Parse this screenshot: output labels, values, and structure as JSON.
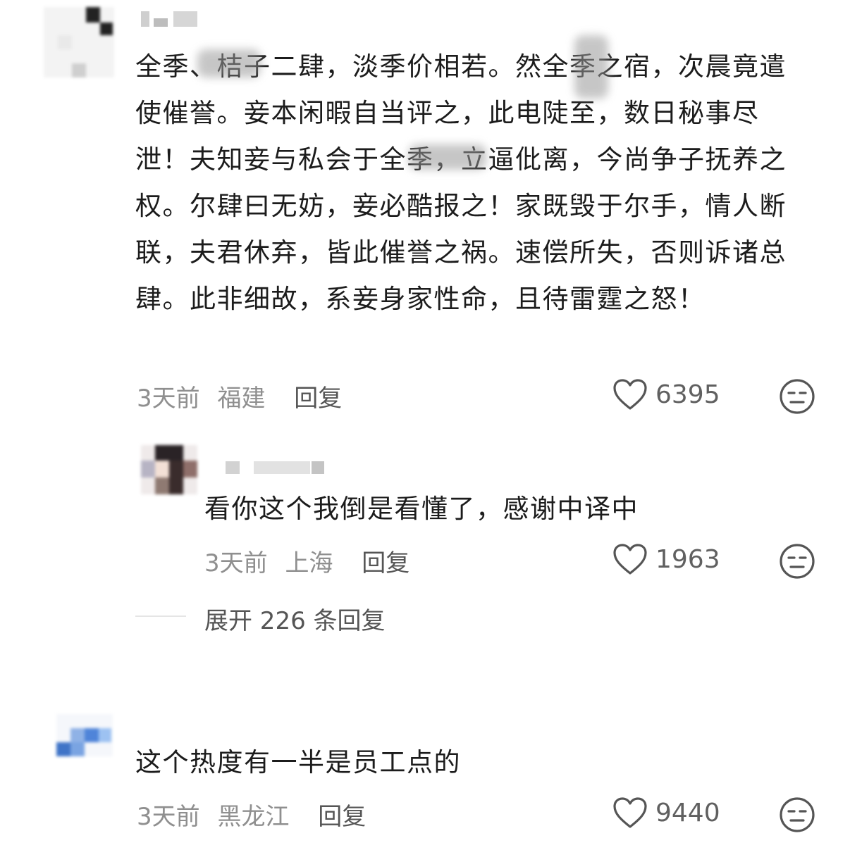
{
  "comments": [
    {
      "text": "全季、桔子二肆，淡季价相若。然全季之宿，次晨竟遣使催誉。妾本闲暇自当评之，此电陡至，数日秘事尽泄！夫知妾与私会于全季，立逼仳离，今尚争子抚养之权。尔肆曰无妨，妾必酷报之！家既毁于尔手，情人断联，夫君休弃，皆此催誉之祸。速偿所失，否则诉诸总肆。此非细故，系妾身家性命，且待雷霆之怒！",
      "time": "3天前",
      "location": "福建",
      "reply_label": "回复",
      "likes": "6395"
    },
    {
      "text": "看你这个我倒是看懂了，感谢中译中",
      "time": "3天前",
      "location": "上海",
      "reply_label": "回复",
      "likes": "1963"
    },
    {
      "text": "这个热度有一半是员工点的",
      "time": "3天前",
      "location": "黑龙江",
      "reply_label": "回复",
      "likes": "9440"
    }
  ],
  "expand_replies": "展开 226 条回复",
  "icons": {
    "like": "heart-outline-icon",
    "dislike": "expressionless-face-icon"
  },
  "colors": {
    "text": "#1c1c1c",
    "meta": "#8f8f8f",
    "icon": "#555555"
  }
}
